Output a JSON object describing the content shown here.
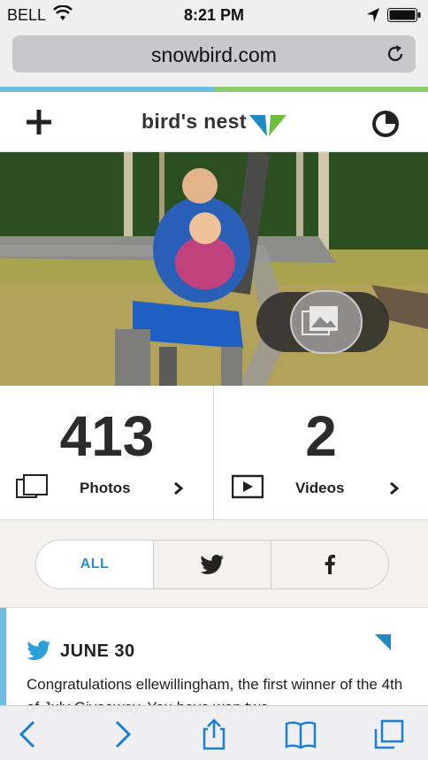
{
  "status_bar": {
    "carrier": "BELL",
    "time": "8:21 PM"
  },
  "browser": {
    "url": "snowbird.com"
  },
  "header": {
    "logo_text": "bird's nest",
    "accent_blue": "#1f8ac4",
    "accent_green": "#6cbf3a"
  },
  "hero": {
    "icons": {
      "gallery": "gallery-icon"
    }
  },
  "stats": {
    "photos": {
      "count": "413",
      "label": "Photos",
      "icon": "photos-icon"
    },
    "videos": {
      "count": "2",
      "label": "Videos",
      "icon": "video-icon"
    }
  },
  "filters": {
    "all_label": "ALL",
    "twitter_icon": "twitter-icon",
    "facebook_icon": "facebook-icon"
  },
  "post": {
    "date": "JUNE 30",
    "text": "Congratulations ellewillingham, the first winner of the 4th of July Giveaway. You have won two"
  },
  "colors": {
    "twitter_blue": "#2a9fd8",
    "progress_blue": "#6cbde4",
    "progress_green": "#8ecb6e"
  }
}
